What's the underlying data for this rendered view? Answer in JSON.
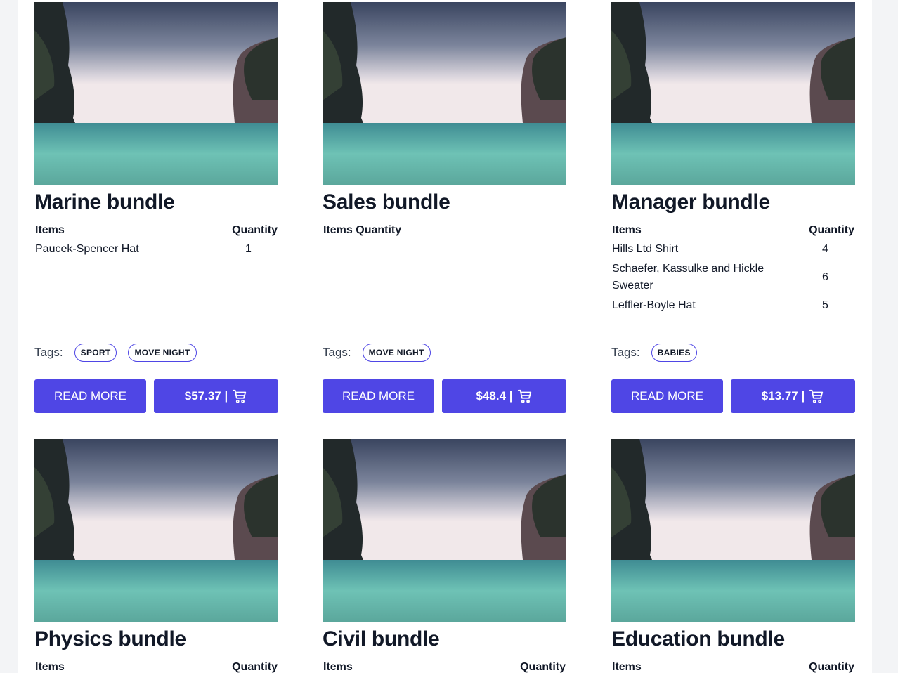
{
  "colors": {
    "accent": "#4f46e5",
    "page_bg": "#f3f4f6",
    "panel_bg": "#ffffff"
  },
  "labels": {
    "items_header": "Items",
    "quantity_header": "Quantity",
    "tags_label": "Tags:",
    "read_more": "READ MORE",
    "cart_icon": "shopping-cart-icon"
  },
  "bundles": [
    {
      "title": "Marine bundle",
      "items": [
        {
          "name": "Paucek-Spencer Hat",
          "qty": "1"
        }
      ],
      "tags": [
        "SPORT",
        "MOVE NIGHT"
      ],
      "price": "$57.37 |"
    },
    {
      "title": "Sales bundle",
      "items_header_combined": "Items Quantity",
      "items": [],
      "tags": [
        "MOVE NIGHT"
      ],
      "price": "$48.4 |"
    },
    {
      "title": "Manager bundle",
      "items": [
        {
          "name": "Hills Ltd Shirt",
          "qty": "4"
        },
        {
          "name": "Schaefer, Kassulke and Hickle Sweater",
          "qty": "6"
        },
        {
          "name": "Leffler-Boyle Hat",
          "qty": "5"
        }
      ],
      "tags": [
        "BABIES"
      ],
      "price": "$13.77 |"
    },
    {
      "title": "Physics bundle"
    },
    {
      "title": "Civil bundle"
    },
    {
      "title": "Education bundle"
    }
  ]
}
